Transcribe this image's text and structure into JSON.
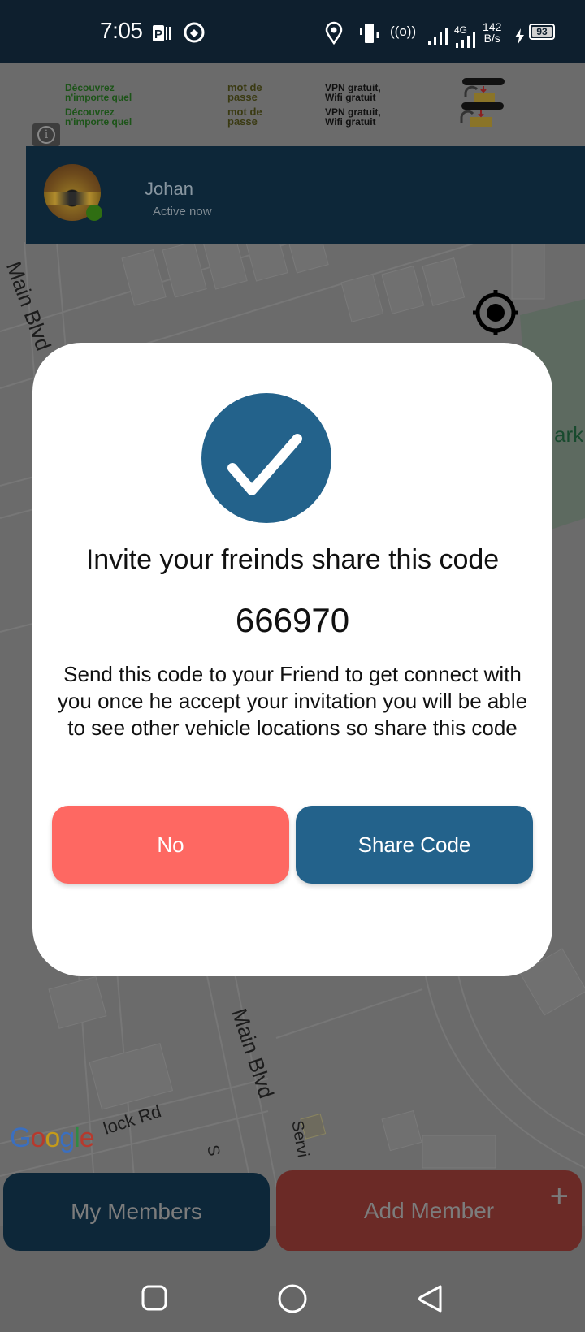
{
  "status_bar": {
    "time": "7:05",
    "network_speed_value": "142",
    "network_speed_unit": "B/s",
    "network_type": "4G",
    "battery_level": "93",
    "icons": [
      "parking-app-icon",
      "q-app-icon",
      "location-icon",
      "vibrate-icon",
      "hotspot-icon",
      "signal-icon",
      "signal-4g-icon",
      "charging-icon",
      "battery-icon"
    ]
  },
  "ad_banner": {
    "rows": [
      {
        "col1_line1": "Découvrez",
        "col1_line2": "n'importe quel",
        "col2_line1": "mot de",
        "col2_line2": "passe",
        "col3_line1": "VPN gratuit,",
        "col3_line2": "Wifi gratuit",
        "badge": "WIFI"
      },
      {
        "col1_line1": "Découvrez",
        "col1_line2": "n'importe quel",
        "col2_line1": "mot de",
        "col2_line2": "passe",
        "col3_line1": "VPN gratuit,",
        "col3_line2": "Wifi gratuit",
        "badge": "WIFI"
      }
    ],
    "info_icon": "i"
  },
  "user_card": {
    "name": "Johan",
    "status": "Active now",
    "online_color": "#2f6e12"
  },
  "map": {
    "labels": {
      "street_top_left": "Main Blvd",
      "park": "ark",
      "street_bottom": "Main Blvd",
      "road_bottom_left": "lock Rd",
      "service_road": "Servi",
      "s_road": "S"
    },
    "google_logo": [
      "G",
      "o",
      "o",
      "g",
      "l",
      "e"
    ],
    "google_colors": [
      "#4285F4",
      "#EA4335",
      "#FBBC05",
      "#4285F4",
      "#34A853",
      "#EA4335"
    ]
  },
  "dialog": {
    "title": "Invite your freinds share this code",
    "code": "666970",
    "message": "Send this code to your Friend to get connect with you once he accept your invitation you will be able to see other vehicle locations so share this code",
    "no_label": "No",
    "share_label": "Share Code",
    "accent_color": "#23628b",
    "danger_color": "#fe6862"
  },
  "bottom_actions": {
    "my_members_label": "My Members",
    "add_member_label": "Add Member",
    "add_icon": "+"
  },
  "nav_bar": {
    "recents": "recents-button",
    "home": "home-button",
    "back": "back-button"
  }
}
